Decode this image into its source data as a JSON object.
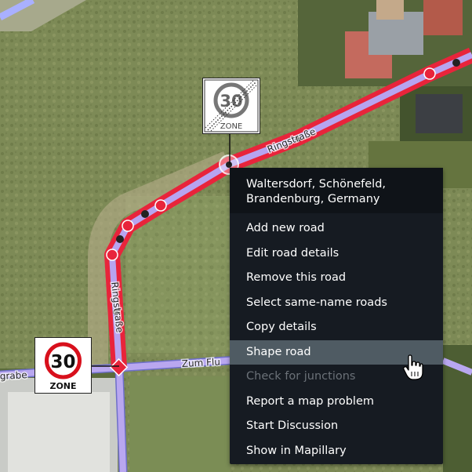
{
  "map": {
    "streets": [
      {
        "name": "Ringstraße"
      },
      {
        "name": "Ringstraße"
      },
      {
        "name": "Zum Flu"
      },
      {
        "name": "grabe"
      }
    ],
    "signs": [
      {
        "kind": "end-of-30-zone",
        "number": "30",
        "text": "ZONE"
      },
      {
        "kind": "30-zone",
        "number": "30",
        "text": "ZONE"
      }
    ],
    "colors": {
      "selected_road": "#e8243b",
      "road_casing": "#a9b0ff",
      "node": "#e8243b"
    }
  },
  "context_menu": {
    "header": {
      "line1": "Waltersdorf, Schönefeld,",
      "line2": "Brandenburg, Germany"
    },
    "items": [
      {
        "label": "Add new road",
        "state": "normal"
      },
      {
        "label": "Edit road details",
        "state": "normal"
      },
      {
        "label": "Remove this road",
        "state": "normal"
      },
      {
        "label": "Select same-name roads",
        "state": "normal"
      },
      {
        "label": "Copy details",
        "state": "normal"
      },
      {
        "label": "Shape road",
        "state": "hover"
      },
      {
        "label": "Check for junctions",
        "state": "disabled"
      },
      {
        "label": "Report a map problem",
        "state": "normal"
      },
      {
        "label": "Start Discussion",
        "state": "normal"
      },
      {
        "label": "Show in Mapillary",
        "state": "normal"
      }
    ]
  },
  "cursor": {
    "icon": "hand-pointer-icon"
  }
}
